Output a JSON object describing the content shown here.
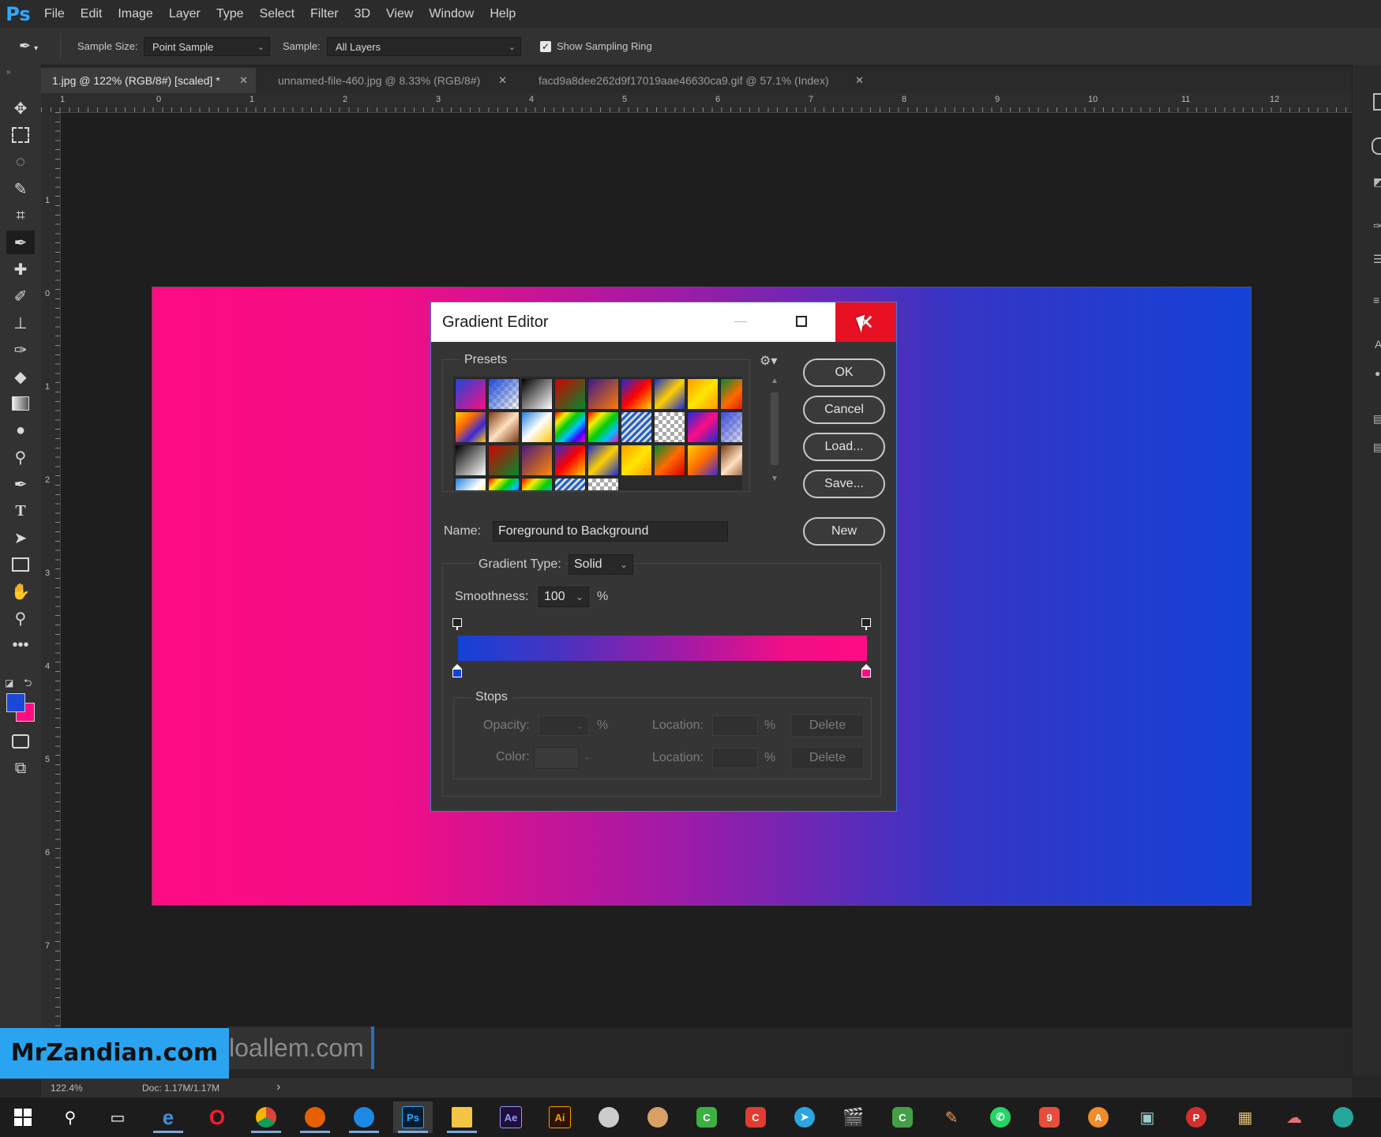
{
  "app": {
    "logo": "Ps"
  },
  "menu": [
    "File",
    "Edit",
    "Image",
    "Layer",
    "Type",
    "Select",
    "Filter",
    "3D",
    "View",
    "Window",
    "Help"
  ],
  "options": {
    "sample_size_label": "Sample Size:",
    "sample_size_value": "Point Sample",
    "sample_label": "Sample:",
    "sample_value": "All Layers",
    "show_ring_label": "Show Sampling Ring",
    "show_ring_checked": true
  },
  "tabs": [
    {
      "label": "1.jpg @ 122% (RGB/8#) [scaled] *",
      "active": true
    },
    {
      "label": "unnamed-file-460.jpg @ 8.33% (RGB/8#)",
      "active": false
    },
    {
      "label": "facd9a8dee262d9f17019aae46630ca9.gif @ 57.1% (Index)",
      "active": false
    }
  ],
  "ruler": {
    "h": [
      "1",
      "0",
      "1",
      "2",
      "3",
      "4",
      "5",
      "6",
      "7",
      "8",
      "9",
      "10",
      "11",
      "12"
    ],
    "v": [
      "1",
      "0",
      "1",
      "2",
      "3",
      "4",
      "5",
      "6",
      "7"
    ]
  },
  "colors": {
    "foreground": "#1a48d8",
    "background": "#ff0c83",
    "accent": "#31a8ff",
    "close_red": "#e81123"
  },
  "dialog": {
    "title": "Gradient Editor",
    "presets_label": "Presets",
    "ok": "OK",
    "cancel": "Cancel",
    "load": "Load...",
    "save": "Save...",
    "new": "New",
    "name_label": "Name:",
    "name_value": "Foreground to Background",
    "gradient_type_label": "Gradient Type:",
    "gradient_type_value": "Solid",
    "smoothness_label": "Smoothness:",
    "smoothness_value": "100",
    "percent": "%",
    "stops_label": "Stops",
    "opacity_label": "Opacity:",
    "color_label": "Color:",
    "location_label": "Location:",
    "delete": "Delete"
  },
  "status": {
    "zoom": "122.4%",
    "doc": "Doc: 1.17M/1.17M",
    "arrow": "›"
  },
  "watermark": {
    "brand": "MrZandian.com",
    "overlay": "loallem.com"
  }
}
